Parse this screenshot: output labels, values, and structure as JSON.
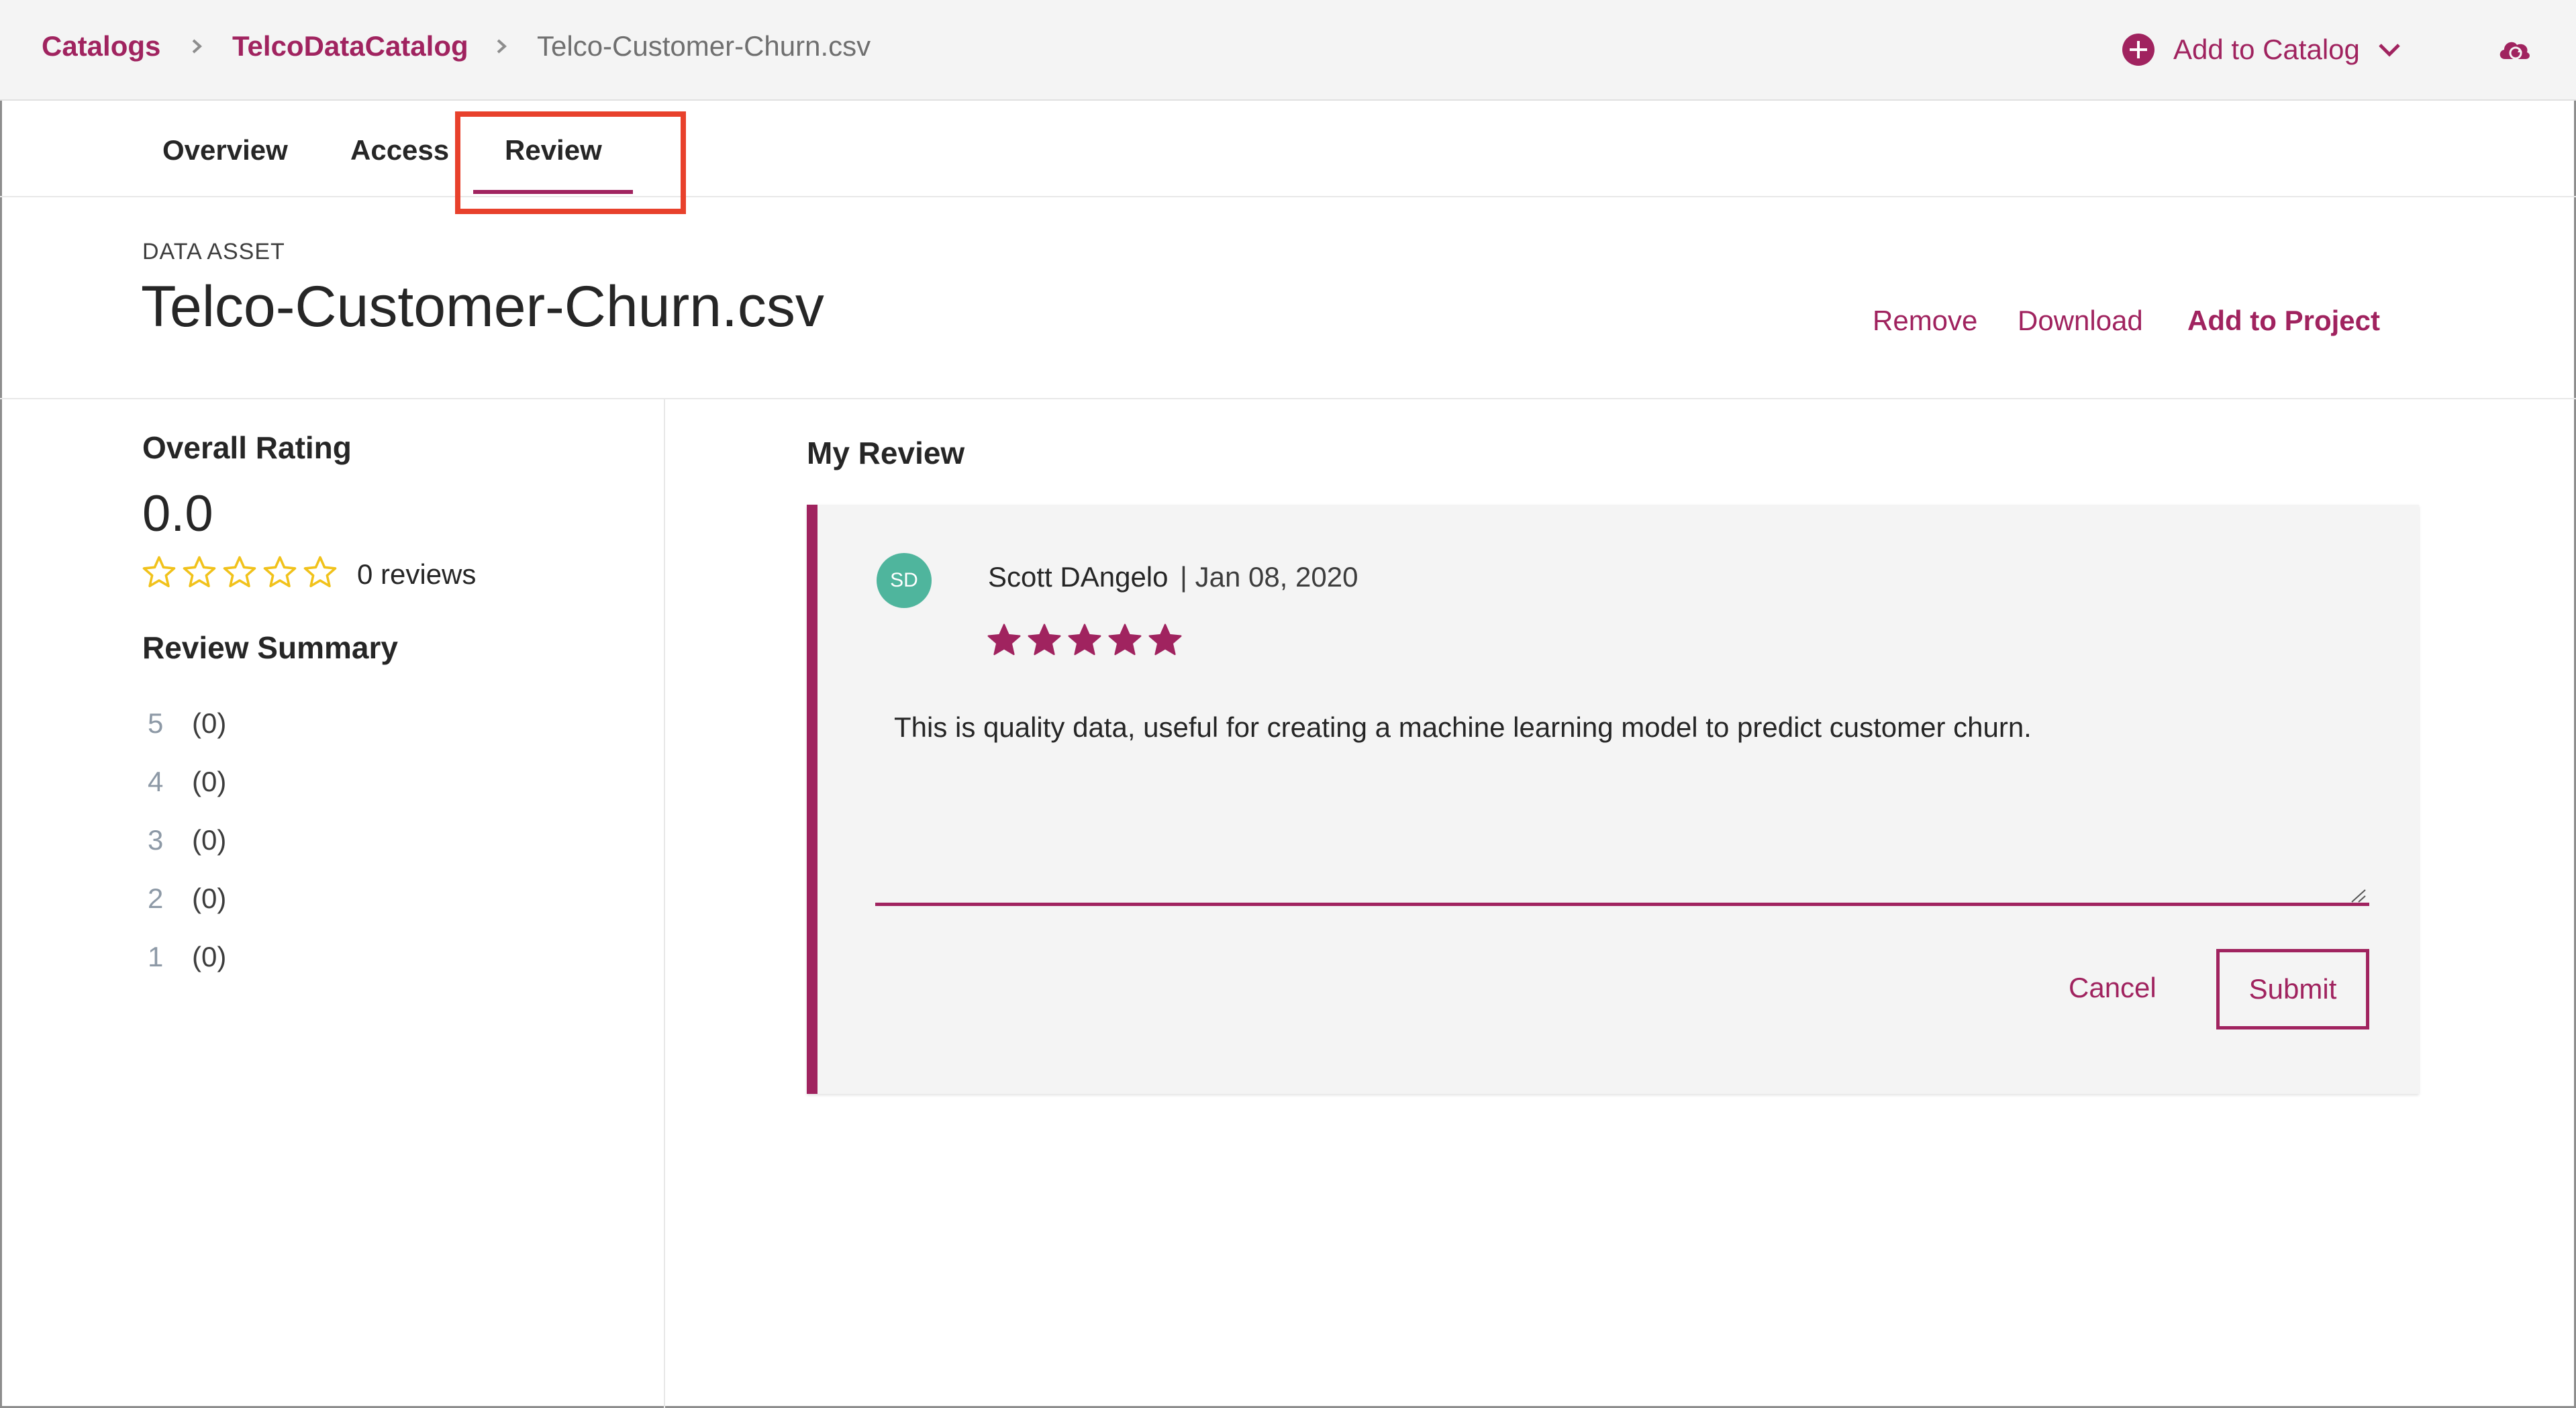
{
  "breadcrumb": {
    "items": [
      "Catalogs",
      "TelcoDataCatalog"
    ],
    "current": "Telco-Customer-Churn.csv"
  },
  "header_actions": {
    "add_to_catalog_label": "Add to Catalog",
    "add_icon": "plus-circle-icon",
    "dropdown_icon": "chevron-down-icon",
    "cloud_icon": "cloud-sync-icon"
  },
  "tabs": [
    {
      "label": "Overview"
    },
    {
      "label": "Access"
    },
    {
      "label": "Review",
      "selected": true
    }
  ],
  "asset": {
    "type_label": "DATA ASSET",
    "title": "Telco-Customer-Churn.csv",
    "actions": {
      "remove": "Remove",
      "download": "Download",
      "add_to_project": "Add to Project"
    }
  },
  "rating": {
    "title": "Overall Rating",
    "value": "0.0",
    "stars_filled": 0,
    "stars_total": 5,
    "review_count": "0 reviews",
    "summary_title": "Review Summary",
    "summary": [
      {
        "stars": "5",
        "count": "(0)"
      },
      {
        "stars": "4",
        "count": "(0)"
      },
      {
        "stars": "3",
        "count": "(0)"
      },
      {
        "stars": "2",
        "count": "(0)"
      },
      {
        "stars": "1",
        "count": "(0)"
      }
    ]
  },
  "my_review": {
    "title": "My Review",
    "avatar_initials": "SD",
    "reviewer": "Scott DAngelo",
    "date": "| Jan 08, 2020",
    "stars_selected": 5,
    "text": "This is quality data, useful for creating a machine learning model to predict customer churn.",
    "cancel_label": "Cancel",
    "submit_label": "Submit"
  },
  "colors": {
    "accent": "#a0235f",
    "star_empty_outline": "#f1c21b",
    "avatar": "#4fb59d",
    "highlight_box": "#e8412c"
  }
}
